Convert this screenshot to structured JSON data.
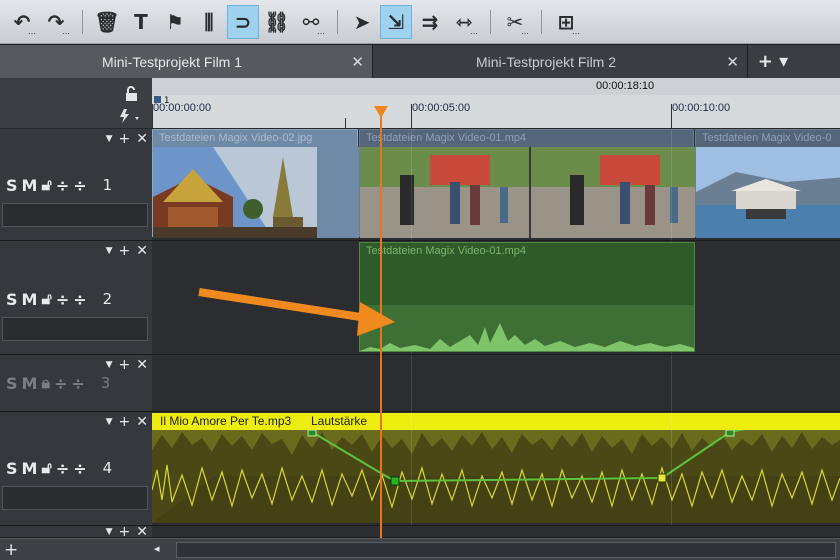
{
  "toolbar": {
    "buttons": [
      {
        "icon": "undo-icon",
        "glyph": "↶",
        "dots": true
      },
      {
        "icon": "redo-icon",
        "glyph": "↷",
        "dots": true
      },
      {
        "sep": true
      },
      {
        "icon": "delete-icon",
        "glyph": "🗑",
        "dots": false
      },
      {
        "icon": "title-text-icon",
        "glyph": "T",
        "dots": false
      },
      {
        "icon": "marker-flag-icon",
        "glyph": "⚑",
        "dots": false
      },
      {
        "icon": "mixer-icon",
        "glyph": "⫼",
        "dots": false
      },
      {
        "icon": "magnet-snap-icon",
        "glyph": "⊃",
        "dots": false,
        "active": true
      },
      {
        "icon": "group-link-icon",
        "glyph": "⛓",
        "dots": false
      },
      {
        "icon": "ungroup-icon",
        "glyph": "⚯",
        "dots": true
      },
      {
        "sep": true
      },
      {
        "icon": "pointer-icon",
        "glyph": "➤",
        "dots": false
      },
      {
        "icon": "mouse-mode-icon",
        "glyph": "⇲",
        "dots": false,
        "active": true
      },
      {
        "icon": "ripple-mode-icon",
        "glyph": "⇉",
        "dots": false
      },
      {
        "icon": "stretch-mode-icon",
        "glyph": "⇿",
        "dots": true
      },
      {
        "sep": true
      },
      {
        "icon": "cut-scissors-icon",
        "glyph": "✂",
        "dots": true
      },
      {
        "sep": true
      },
      {
        "icon": "insert-icon",
        "glyph": "⊞",
        "dots": true
      }
    ]
  },
  "tabs": [
    {
      "label": "Mini-Testprojekt Film 1",
      "active": true
    },
    {
      "label": "Mini-Testprojekt Film 2",
      "active": false
    }
  ],
  "tab_add": "+ ▾",
  "ruler": {
    "current_time": "00:00:18:10",
    "marker_number": "1",
    "ticks": [
      "00:00:00:00",
      "00:00:05:00",
      "00:00:10:00"
    ]
  },
  "tracks": [
    {
      "number": "1",
      "clips": [
        {
          "title": "Testdateien Magix Video-02.jpg"
        },
        {
          "title": "Testdateien Magix Video-01.mp4"
        },
        {
          "title": "Testdateien Magix Video-0"
        }
      ]
    },
    {
      "number": "2",
      "clips": [
        {
          "title": "Testdateien Magix Video-01.mp4"
        }
      ]
    },
    {
      "number": "3",
      "clips": []
    },
    {
      "number": "4",
      "clips": [
        {
          "title": "Il Mio Amore Per Te.mp3",
          "volume_label": "Lautstärke"
        }
      ]
    }
  ],
  "track_buttons": {
    "solo": "S",
    "mute": "M",
    "close": "✕",
    "add": "+"
  },
  "colors": {
    "playhead": "#e8741c",
    "audio_clip_header": "#e8e80a",
    "audio_clip_body": "#6d6a1a",
    "video_audio_clip": "#3e6a34",
    "arrow": "#f08a1e",
    "active_tool": "#9fd2ee"
  }
}
